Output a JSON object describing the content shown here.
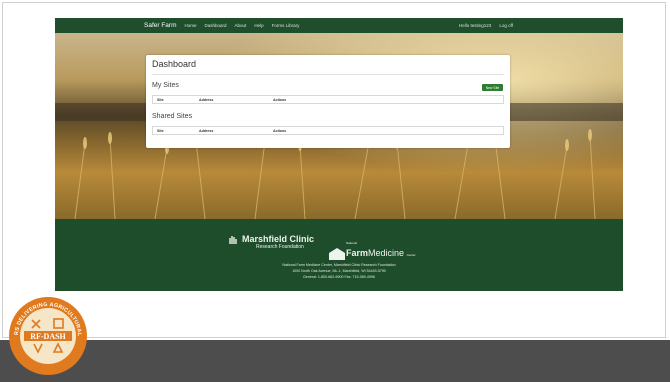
{
  "nav": {
    "brand": "Safer Farm",
    "links": [
      "Home",
      "Dashboard",
      "About",
      "Help",
      "Forms Library"
    ],
    "greeting": "Hello testing123",
    "logout": "Log off"
  },
  "dashboard": {
    "title": "Dashboard",
    "my_sites": {
      "title": "My Sites",
      "new_button": "New Site",
      "columns": [
        "Site",
        "Address",
        "Actions"
      ]
    },
    "shared_sites": {
      "title": "Shared Sites",
      "columns": [
        "Site",
        "Address",
        "Actions"
      ]
    }
  },
  "footer": {
    "clinic_name": "Marshfield Clinic",
    "clinic_sub": "Research Foundation",
    "nfm_national": "National",
    "nfm_farm": "Farm",
    "nfm_medicine": "Medicine",
    "nfm_center": "Center",
    "address_line1": "National Farm Medicine Center, Marshfield Clinic Research Foundation",
    "address_line2": "1000 North Oak Avenue, ML-1, Marshfield, WI 54449-5790",
    "address_line3": "General: 1-800-662-6900 Fax: 715-389-4996"
  },
  "badge": {
    "top_text": "RURAL FIREFIGHTERS DELIVERING AGRICULTURAL SAFETY & HEALTH",
    "center_text": "RF-DASH"
  },
  "colors": {
    "nav_green": "#1f4e2c",
    "button_green": "#2e7d32",
    "badge_orange": "#e07a1f",
    "badge_cream": "#f5e6c8"
  }
}
